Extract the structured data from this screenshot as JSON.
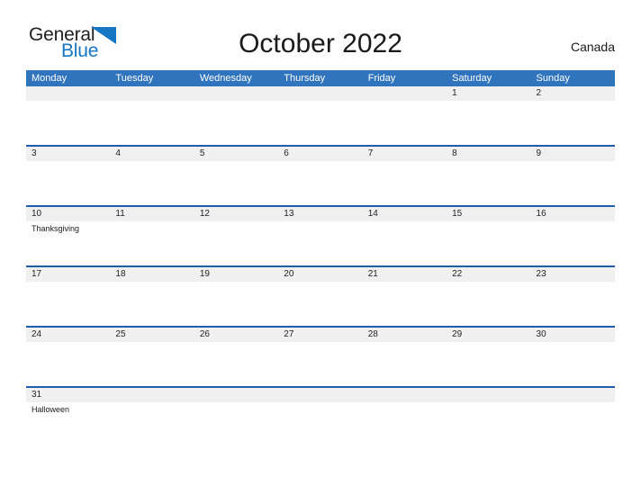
{
  "brand": {
    "name_part1": "General",
    "name_part2": "Blue",
    "flag_icon": "flag-triangle-icon",
    "color_dark": "#231f20",
    "color_blue": "#1676c4"
  },
  "header": {
    "title": "October 2022",
    "country": "Canada"
  },
  "colors": {
    "header_band": "#2f74bd",
    "row_border": "#1f5fa8",
    "number_band": "#f0f0f0",
    "page_background": "#fefefe",
    "text": "#1a1a1a"
  },
  "calendar": {
    "month": "October",
    "year": "2022",
    "weekday_headers": [
      "Monday",
      "Tuesday",
      "Wednesday",
      "Thursday",
      "Friday",
      "Saturday",
      "Sunday"
    ],
    "weeks": [
      {
        "days": [
          {
            "number": "",
            "events": []
          },
          {
            "number": "",
            "events": []
          },
          {
            "number": "",
            "events": []
          },
          {
            "number": "",
            "events": []
          },
          {
            "number": "",
            "events": []
          },
          {
            "number": "1",
            "events": []
          },
          {
            "number": "2",
            "events": []
          }
        ]
      },
      {
        "days": [
          {
            "number": "3",
            "events": []
          },
          {
            "number": "4",
            "events": []
          },
          {
            "number": "5",
            "events": []
          },
          {
            "number": "6",
            "events": []
          },
          {
            "number": "7",
            "events": []
          },
          {
            "number": "8",
            "events": []
          },
          {
            "number": "9",
            "events": []
          }
        ]
      },
      {
        "days": [
          {
            "number": "10",
            "events": [
              "Thanksgiving"
            ]
          },
          {
            "number": "11",
            "events": []
          },
          {
            "number": "12",
            "events": []
          },
          {
            "number": "13",
            "events": []
          },
          {
            "number": "14",
            "events": []
          },
          {
            "number": "15",
            "events": []
          },
          {
            "number": "16",
            "events": []
          }
        ]
      },
      {
        "days": [
          {
            "number": "17",
            "events": []
          },
          {
            "number": "18",
            "events": []
          },
          {
            "number": "19",
            "events": []
          },
          {
            "number": "20",
            "events": []
          },
          {
            "number": "21",
            "events": []
          },
          {
            "number": "22",
            "events": []
          },
          {
            "number": "23",
            "events": []
          }
        ]
      },
      {
        "days": [
          {
            "number": "24",
            "events": []
          },
          {
            "number": "25",
            "events": []
          },
          {
            "number": "26",
            "events": []
          },
          {
            "number": "27",
            "events": []
          },
          {
            "number": "28",
            "events": []
          },
          {
            "number": "29",
            "events": []
          },
          {
            "number": "30",
            "events": []
          }
        ]
      },
      {
        "days": [
          {
            "number": "31",
            "events": [
              "Halloween"
            ]
          },
          {
            "number": "",
            "events": []
          },
          {
            "number": "",
            "events": []
          },
          {
            "number": "",
            "events": []
          },
          {
            "number": "",
            "events": []
          },
          {
            "number": "",
            "events": []
          },
          {
            "number": "",
            "events": []
          }
        ]
      }
    ]
  }
}
